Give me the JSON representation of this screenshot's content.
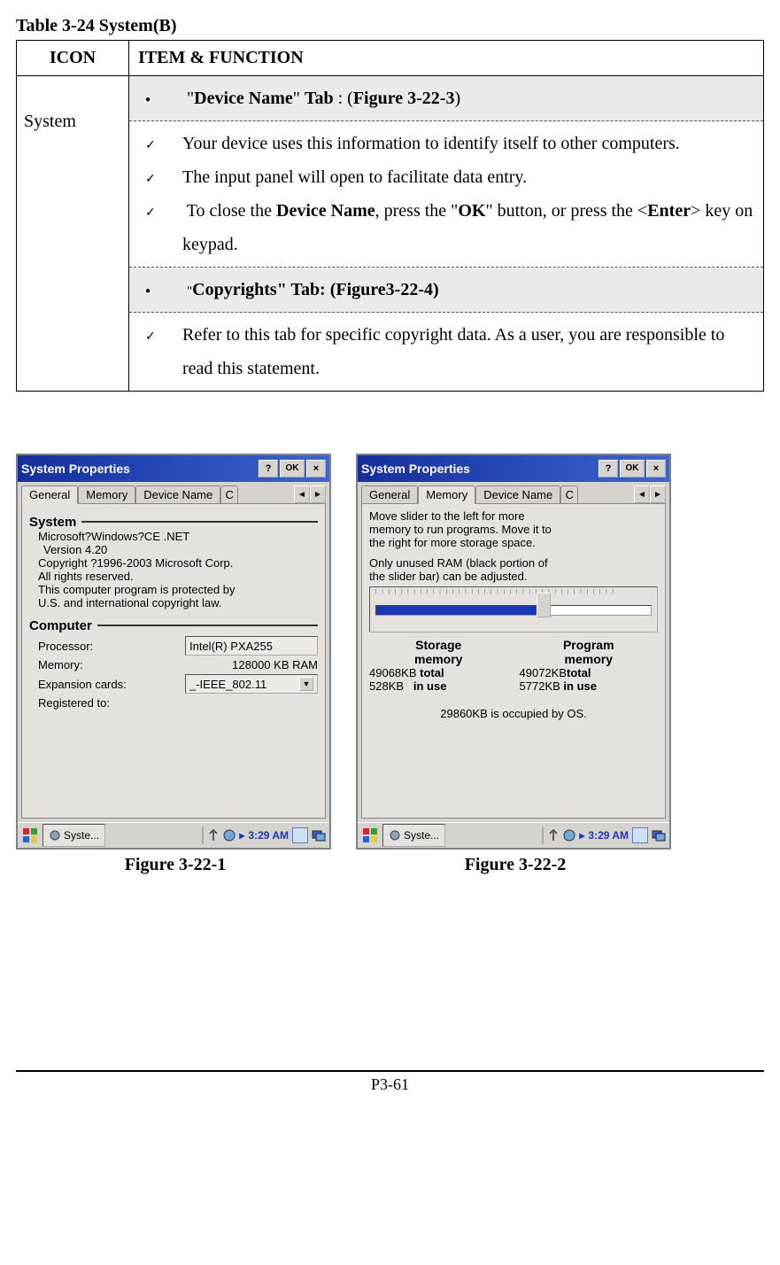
{
  "table": {
    "caption": "Table 3-24    System(B)",
    "headers": {
      "icon": "ICON",
      "item": "ITEM & FUNCTION"
    },
    "icon_label": "System",
    "tab1_line": {
      "pre": "\"",
      "b1": "Device Name",
      "mid1": "\" ",
      "b2": "Tab",
      "mid2": " : (",
      "b3": "Figure 3-22-3",
      "post": ")"
    },
    "chk1": "Your device uses this information to identify itself to other computers.",
    "chk2": "The input panel will open to facilitate data entry.",
    "chk3": {
      "pre": "To close the ",
      "b1": "Device Name",
      "mid1": ", press the \"",
      "b2": "OK",
      "mid2": "\" button, or press the <",
      "b3": "Enter",
      "post": "> key on keypad."
    },
    "tab2_line": {
      "pre": "\"",
      "rest": "Copyrights\" Tab: (Figure3-22-4)"
    },
    "chk4": "Refer to this tab for specific copyright data. As a user, you are responsible to read this statement."
  },
  "shot1": {
    "title": "System Properties",
    "btn_help": "?",
    "btn_ok": "OK",
    "btn_close": "×",
    "tabs": {
      "t1": "General",
      "t2": "Memory",
      "t3": "Device Name",
      "t4": "C",
      "left": "◄",
      "right": "►"
    },
    "group_system": "System",
    "sys_lines": {
      "l1": "Microsoft?Windows?CE .NET",
      "l2": "Version 4.20",
      "l3": "Copyright ?1996-2003 Microsoft Corp.",
      "l4": "All rights reserved.",
      "l5": "This computer program is protected by",
      "l6": "U.S. and international copyright law."
    },
    "group_computer": "Computer",
    "comp": {
      "proc_label": "Processor:",
      "proc_val": "Intel(R) PXA255",
      "mem_label": "Memory:",
      "mem_val": "128000 KB  RAM",
      "exp_label": "Expansion cards:",
      "exp_val": "_-IEEE_802.11",
      "reg_label": "Registered to:"
    },
    "taskbar": {
      "task": "Syste...",
      "time": "3:29 AM"
    }
  },
  "shot2": {
    "title": "System Properties",
    "btn_help": "?",
    "btn_ok": "OK",
    "btn_close": "×",
    "tabs": {
      "t1": "General",
      "t2": "Memory",
      "t3": "Device Name",
      "t4": "C",
      "left": "◄",
      "right": "►"
    },
    "text1a": "Move slider to the left for more",
    "text1b": "memory to run programs. Move it to",
    "text1c": "the right for more storage space.",
    "text2a": "Only unused RAM (black portion of",
    "text2b": "the slider bar) can be adjusted.",
    "mem": {
      "left_head1": "Storage",
      "left_head2": "memory",
      "right_head1": "Program",
      "right_head2": "memory",
      "l_total_num": "49068KB",
      "r_total_num": "49072KB",
      "total_word": "total",
      "l_use_num": "528KB",
      "r_use_num": "5772KB",
      "use_word": "in use",
      "os_line": "29860KB is occupied by OS."
    },
    "taskbar": {
      "task": "Syste...",
      "time": "3:29 AM"
    }
  },
  "figures": {
    "f1": "Figure 3-22-1",
    "f2": "Figure 3-22-2"
  },
  "page_number": "P3-61"
}
